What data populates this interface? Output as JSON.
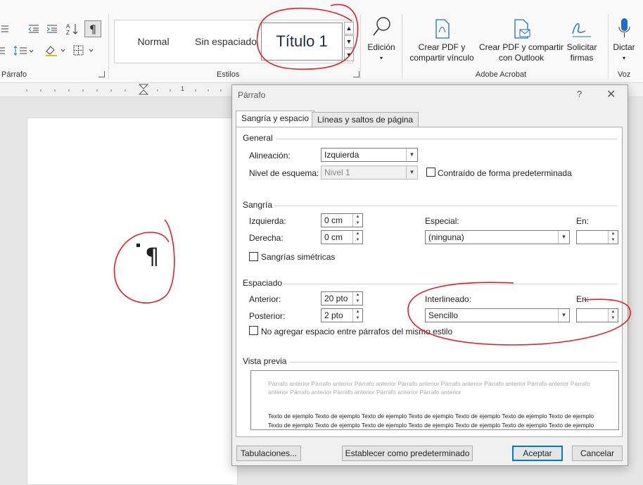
{
  "ribbon": {
    "parrafo_label": "Párrafo",
    "estilos_label": "Estilos",
    "acrobat_label": "Adobe Acrobat",
    "voz_label": "Voz",
    "styles": {
      "normal": "Normal",
      "sin_espaciado": "Sin espaciado",
      "titulo1": "Título 1"
    },
    "edicion": "Edición",
    "crear_pdf_vinculo_1": "Crear PDF y",
    "crear_pdf_vinculo_2": "compartir vínculo",
    "crear_pdf_outlook_1": "Crear PDF y compartir",
    "crear_pdf_outlook_2": "con Outlook",
    "solicitar_1": "Solicitar",
    "solicitar_2": "firmas",
    "dictar": "Dictar"
  },
  "ruler": {
    "mark_1": "1"
  },
  "document": {
    "pilcrow": "¶"
  },
  "dialog": {
    "title": "Párrafo",
    "help": "?",
    "close": "✕",
    "tabs": [
      "Sangría y espacio",
      "Líneas y saltos de página"
    ],
    "general": {
      "section": "General",
      "alineacion_label": "Alineación:",
      "alineacion_value": "Izquierda",
      "nivel_label": "Nivel de esquema:",
      "nivel_value": "Nivel 1",
      "contraido_label": "Contraído de forma predeterminada"
    },
    "sangria": {
      "section": "Sangría",
      "izquierda_label": "Izquierda:",
      "izquierda_value": "0 cm",
      "derecha_label": "Derecha:",
      "derecha_value": "0 cm",
      "especial_label": "Especial:",
      "especial_value": "(ninguna)",
      "en_label": "En:",
      "simetricas_label": "Sangrías simétricas"
    },
    "espaciado": {
      "section": "Espaciado",
      "anterior_label": "Anterior:",
      "anterior_value": "20 pto",
      "posterior_label": "Posterior:",
      "posterior_value": "2 pto",
      "interlineado_label": "Interlineado:",
      "interlineado_value": "Sencillo",
      "en_label": "En:",
      "no_agregar_label": "No agregar espacio entre párrafos del mismo estilo"
    },
    "preview": {
      "section": "Vista previa",
      "prev_text": "Párrafo anterior Párrafo anterior Párrafo anterior Párrafo anterior Párrafo anterior Párrafo anterior Párrafo anterior Párrafo anterior Párrafo anterior Párrafo anterior Párrafo anterior Párrafo anterior",
      "sample_text": "Texto de ejemplo Texto de ejemplo Texto de ejemplo Texto de ejemplo Texto de ejemplo Texto de ejemplo Texto de ejemplo Texto de ejemplo Texto de ejemplo Texto de ejemplo Texto de ejemplo Texto de ejemplo Texto de ejemplo Texto de ejemplo"
    },
    "buttons": {
      "tabulaciones": "Tabulaciones...",
      "predeterminado": "Establecer como predeterminado",
      "aceptar": "Aceptar",
      "cancelar": "Cancelar"
    }
  },
  "colors": {
    "accent": "#0078d7",
    "annotation": "#e0202a",
    "icon_blue": "#1a6fc9"
  }
}
